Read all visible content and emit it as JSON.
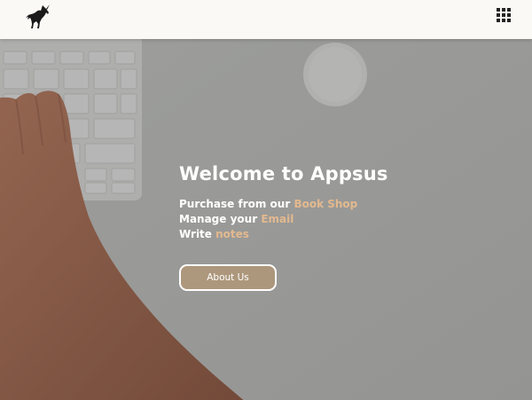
{
  "header": {
    "logo_icon": "unicorn-logo-icon",
    "apps_icon": "grid-apps-icon"
  },
  "hero": {
    "title": "Welcome to Appsus",
    "features": [
      {
        "prefix": "Purchase from our",
        "link": "Book Shop"
      },
      {
        "prefix": "Manage your",
        "link": "Email"
      },
      {
        "prefix": "Write",
        "link": "notes"
      }
    ],
    "button_label": "About Us"
  },
  "colors": {
    "accent": "#e3b98f",
    "header_bg": "#fbf9f5",
    "button_bg": "#b0967a"
  }
}
